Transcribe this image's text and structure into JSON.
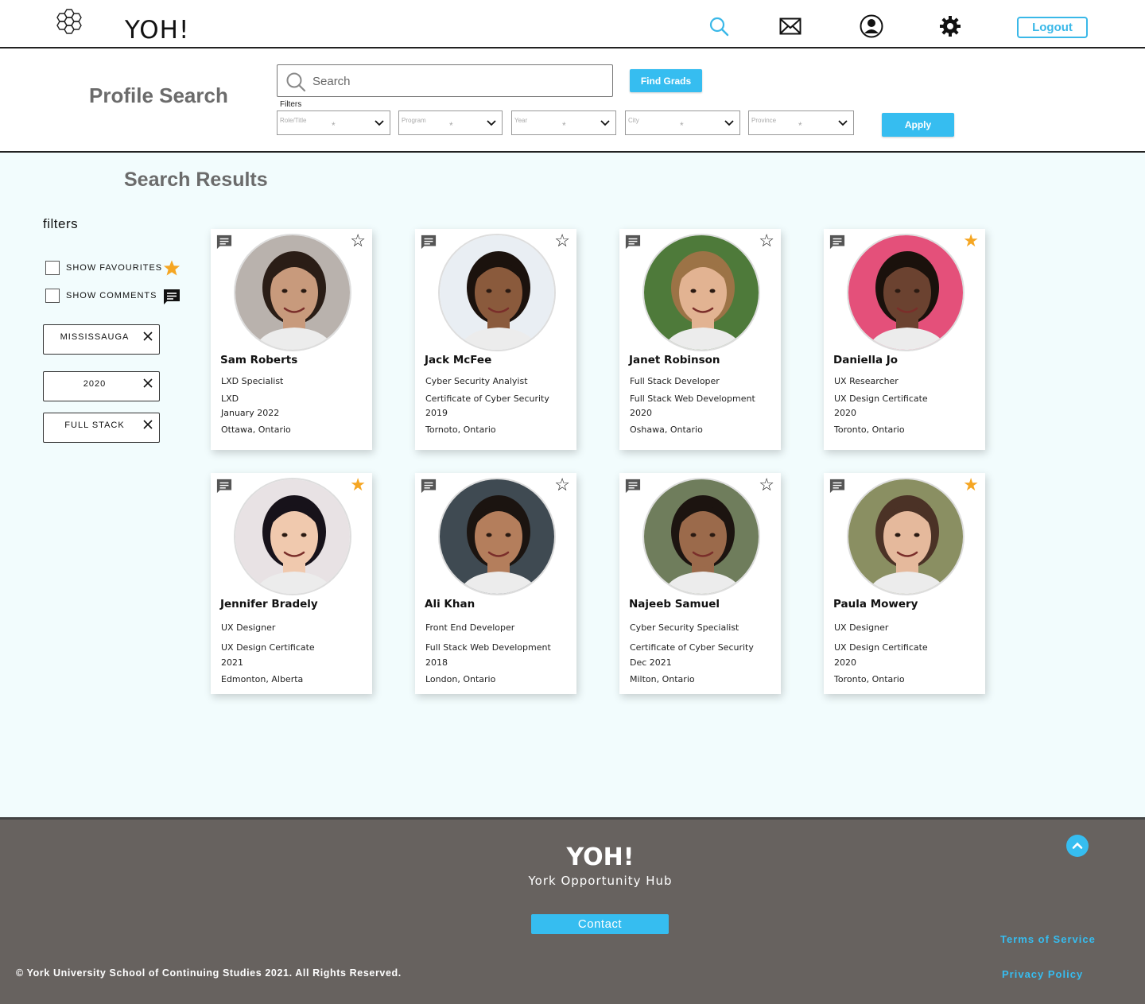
{
  "header": {
    "brand": "YOH!",
    "logout_label": "Logout",
    "icons": [
      "hexagon-logo-icon",
      "search-icon",
      "mail-icon",
      "profile-icon",
      "gear-icon"
    ],
    "accent": "#3ab8e8"
  },
  "search": {
    "page_title": "Profile Search",
    "placeholder": "Search",
    "find_label": "Find Grads",
    "filters_label": "Filters",
    "apply_label": "Apply",
    "dropdowns": [
      {
        "placeholder": "Role/Title",
        "required": "*"
      },
      {
        "placeholder": "Program",
        "required": "*"
      },
      {
        "placeholder": "Year",
        "required": "*"
      },
      {
        "placeholder": "City",
        "required": "*"
      },
      {
        "placeholder": "Province",
        "required": "*"
      }
    ]
  },
  "results": {
    "title": "Search Results",
    "background": "#f2fcfd"
  },
  "sidebar": {
    "title": "filters",
    "show_favourites": "SHOW FAVOURITES",
    "show_comments": "SHOW COMMENTS",
    "tags": [
      "MISSISSAUGA",
      "2020",
      "FULL STACK"
    ]
  },
  "cards": [
    {
      "name": "Sam Roberts",
      "role": "LXD Specialist",
      "program": "LXD",
      "year": "January 2022",
      "location": "Ottawa, Ontario",
      "favourite": false,
      "skin": "#c89a7c",
      "hair": "#2a1d16",
      "bg": "#b9b2ad"
    },
    {
      "name": "Jack McFee",
      "role": "Cyber Security Analyist",
      "program": "Certificate of Cyber Security",
      "year": "2019",
      "location": "Tornoto, Ontario",
      "favourite": false,
      "skin": "#8a5a3c",
      "hair": "#1b120d",
      "bg": "#e9eef3"
    },
    {
      "name": "Janet Robinson",
      "role": "Full Stack Developer",
      "program": "Full Stack Web Development",
      "year": "2020",
      "location": "Oshawa, Ontario",
      "favourite": false,
      "skin": "#e2b392",
      "hair": "#9c7346",
      "bg": "#4e7a3a"
    },
    {
      "name": "Daniella Jo",
      "role": "UX Researcher",
      "program": "UX Design Certificate",
      "year": "2020",
      "location": "Toronto, Ontario",
      "favourite": true,
      "skin": "#6b4230",
      "hair": "#1a110c",
      "bg": "#e4507a"
    },
    {
      "name": "Jennifer Bradely",
      "role": "UX Designer",
      "program": "UX Design Certificate",
      "year": "2021",
      "location": "Edmonton, Alberta",
      "favourite": true,
      "skin": "#f0c9ae",
      "hair": "#17121a",
      "bg": "#e8e2e4"
    },
    {
      "name": "Ali Khan",
      "role": "Front End Developer",
      "program": "Full Stack Web Development",
      "year": "2018",
      "location": "London, Ontario",
      "favourite": false,
      "skin": "#b47e5c",
      "hair": "#1b1410",
      "bg": "#3f4a52"
    },
    {
      "name": "Najeeb Samuel",
      "role": "Cyber Security Specialist",
      "program": "Certificate of Cyber Security",
      "year": "Dec 2021",
      "location": "Milton, Ontario",
      "favourite": false,
      "skin": "#9b6a4b",
      "hair": "#1c1410",
      "bg": "#6f7d5c"
    },
    {
      "name": "Paula Mowery",
      "role": "UX Designer",
      "program": "UX Design Certificate",
      "year": "2020",
      "location": "Toronto, Ontario",
      "favourite": true,
      "skin": "#e5b99c",
      "hair": "#4b3226",
      "bg": "#8a8f62"
    }
  ],
  "footer": {
    "brand": "YOH!",
    "subtitle": "York Opportunity Hub",
    "contact_label": "Contact",
    "terms_label": "Terms of Service",
    "privacy_label": "Privacy Policy",
    "copyright": "© York University School of Continuing Studies 2021. All Rights Reserved.",
    "background": "#67625f"
  }
}
